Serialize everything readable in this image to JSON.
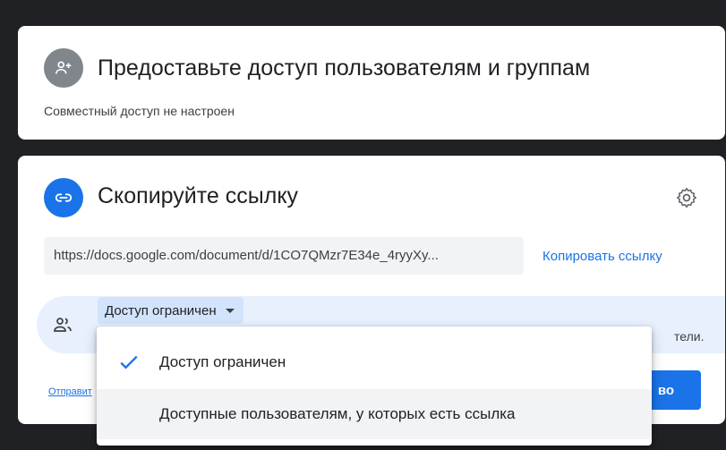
{
  "share_people": {
    "title": "Предоставьте доступ пользователям и группам",
    "status": "Совместный доступ не настроен"
  },
  "link_section": {
    "title": "Скопируйте ссылку",
    "url": "https://docs.google.com/document/d/1CO7QMzr7E34e_4ryyXy...",
    "copy_label": "Копировать ссылку",
    "access_dropdown_label": "Доступ ограничен",
    "hint_tail": "тели.",
    "send_link_label": "Отправит",
    "done_label": "во"
  },
  "access_menu": {
    "options": [
      {
        "label": "Доступ ограничен",
        "selected": true
      },
      {
        "label": "Доступные пользователям, у которых есть ссылка",
        "selected": false
      }
    ]
  },
  "colors": {
    "accent": "#1a73e8",
    "share_icon_bg": "#80868b",
    "link_icon_bg": "#1a73e8",
    "panel_bg": "#e8f0fe",
    "backdrop": "#202124"
  },
  "icons": {
    "share": "person-add-icon",
    "link": "link-icon",
    "settings": "gear-icon",
    "group": "group-icon",
    "dropdown": "caret-down-icon",
    "selected": "checkmark-icon"
  }
}
